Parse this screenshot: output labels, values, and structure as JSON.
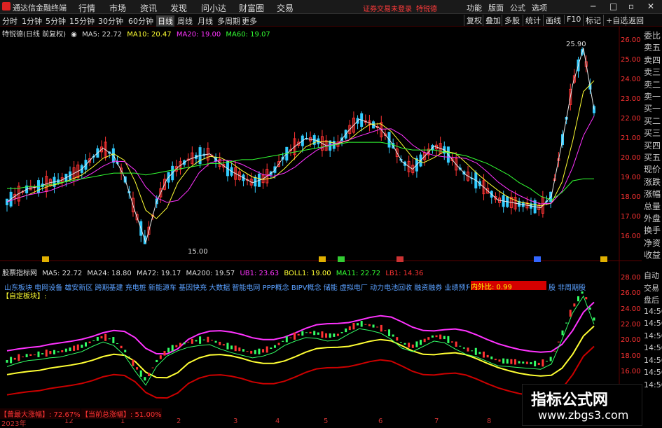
{
  "app": {
    "title": "通达信金融终端"
  },
  "menu": {
    "items": [
      "分时",
      "1分钟",
      "5分钟",
      "15分钟",
      "30分钟",
      "60分钟",
      "日线",
      "周线",
      "月线",
      "多周期",
      "更多"
    ],
    "top_items": [
      "行情",
      "市场",
      "资讯",
      "发现",
      "问小达",
      "财富圈",
      "交易"
    ],
    "notice": "证券交易未登录",
    "stock": "特锐德",
    "right_items": [
      "功能",
      "版面",
      "公式",
      "选项"
    ]
  },
  "toolbar": {
    "title": "特锐德(日线 前复权)",
    "right_items": [
      "复权",
      "叠加",
      "多股",
      "统计",
      "画线",
      "F10",
      "标记",
      "+自选",
      "返回"
    ]
  },
  "main_legend": {
    "ma5": "MA5: 22.72",
    "ma10": "MA10: 20.47",
    "ma20": "MA20: 19.00",
    "ma60": "MA60: 19.07"
  },
  "main_annotations": {
    "high": "25.90",
    "low": "15.00"
  },
  "sub_legend": {
    "title": "股票指标网",
    "ma5": "MA5: 22.72",
    "ma24": "MA24: 18.80",
    "ma72": "MA72: 19.17",
    "ma200": "MA200: 19.57",
    "ub1": "UB1: 23.63",
    "boll1": "BOLL1: 19.00",
    "ma11": "MA11: 22.72",
    "lb1": "LB1: 14.36"
  },
  "sectors": {
    "line": "山东板块 电网设备 雄安新区 跨期基建 充电桩 新能源车 基因快充 大数据 智能电网 PPP概念 BIPV概念 储能 虚拟电厂 动力电池回收 融资融券 业绩预升 2",
    "ratio_label": "内外比: 0.99",
    "tail": "股 非周期股",
    "custom": "【自定板块】:"
  },
  "bottom": {
    "max_gain": "【曾最大涨幅】: 72.67%",
    "cur_gain": "【当前总涨幅】: 51.00%"
  },
  "xaxis": {
    "labels": [
      "2023年",
      "12",
      "1",
      "2",
      "3",
      "4",
      "5",
      "6",
      "7",
      "8",
      "9"
    ]
  },
  "main_yaxis": {
    "ticks": [
      "26.00",
      "25.00",
      "24.00",
      "23.00",
      "22.00",
      "21.00",
      "20.00",
      "19.00",
      "18.00",
      "17.00",
      "16.00"
    ]
  },
  "sub_yaxis": {
    "ticks": [
      "28.00",
      "26.00",
      "24.00",
      "22.00",
      "20.00",
      "18.00",
      "16.00"
    ]
  },
  "sidebar": {
    "items": [
      "委比",
      "卖五",
      "卖四",
      "卖三",
      "卖二",
      "卖一",
      "买一",
      "买二",
      "买三",
      "买四",
      "买五",
      "现价",
      "涨跌",
      "涨幅",
      "总量",
      "外盘",
      "换手",
      "净资",
      "收益"
    ],
    "sub_items": [
      "自动",
      "交易",
      "盘后",
      "14:56",
      "14:56",
      "14:56",
      "14:56",
      "14:56",
      "14:56",
      "14:56"
    ]
  },
  "event_markers": [
    "融",
    "融",
    "减",
    "融",
    "融"
  ],
  "watermark": {
    "line1": "指标公式网",
    "line2": "www.zbgs3.com"
  },
  "chart_data": {
    "type": "line",
    "title": "特锐德(日线 前复权)",
    "series": [
      {
        "name": "MA5",
        "values": [
          17.9,
          18.3,
          18.6,
          18.7,
          18.9,
          19.0,
          19.3,
          19.6,
          20.2,
          20.7,
          20.3,
          19.2,
          17.4,
          15.8,
          17.9,
          19.1,
          19.7,
          20.1,
          20.3,
          20.4,
          19.9,
          19.5,
          19.2,
          18.9,
          19.1,
          19.5,
          20.3,
          20.8,
          21.2,
          21.1,
          20.8,
          20.9,
          21.6,
          22.2,
          22.0,
          21.7,
          21.0,
          20.0,
          19.6,
          20.2,
          20.8,
          20.6,
          19.9,
          19.3,
          19.0,
          18.5,
          18.0,
          17.9,
          17.8,
          17.7,
          17.6,
          18.2,
          21.0,
          24.0,
          25.9,
          22.7
        ]
      },
      {
        "name": "MA60",
        "values": [
          18.6,
          18.6,
          18.7,
          18.7,
          18.8,
          18.9,
          19.0,
          19.1,
          19.2,
          19.3,
          19.4,
          19.4,
          19.4,
          19.3,
          19.4,
          19.5,
          19.6,
          19.7,
          19.8,
          19.9,
          19.9,
          20.0,
          20.1,
          20.1,
          20.2,
          20.3,
          20.4,
          20.5,
          20.6,
          20.7,
          20.8,
          20.9,
          21.0,
          21.0,
          21.0,
          21.0,
          20.9,
          20.7,
          20.6,
          20.6,
          20.6,
          20.5,
          20.4,
          20.3,
          20.1,
          19.9,
          19.6,
          19.3,
          18.9,
          18.6,
          18.2,
          18.0,
          18.4,
          19.0,
          19.1,
          19.1
        ]
      }
    ],
    "ylim": [
      15,
      26.5
    ]
  }
}
